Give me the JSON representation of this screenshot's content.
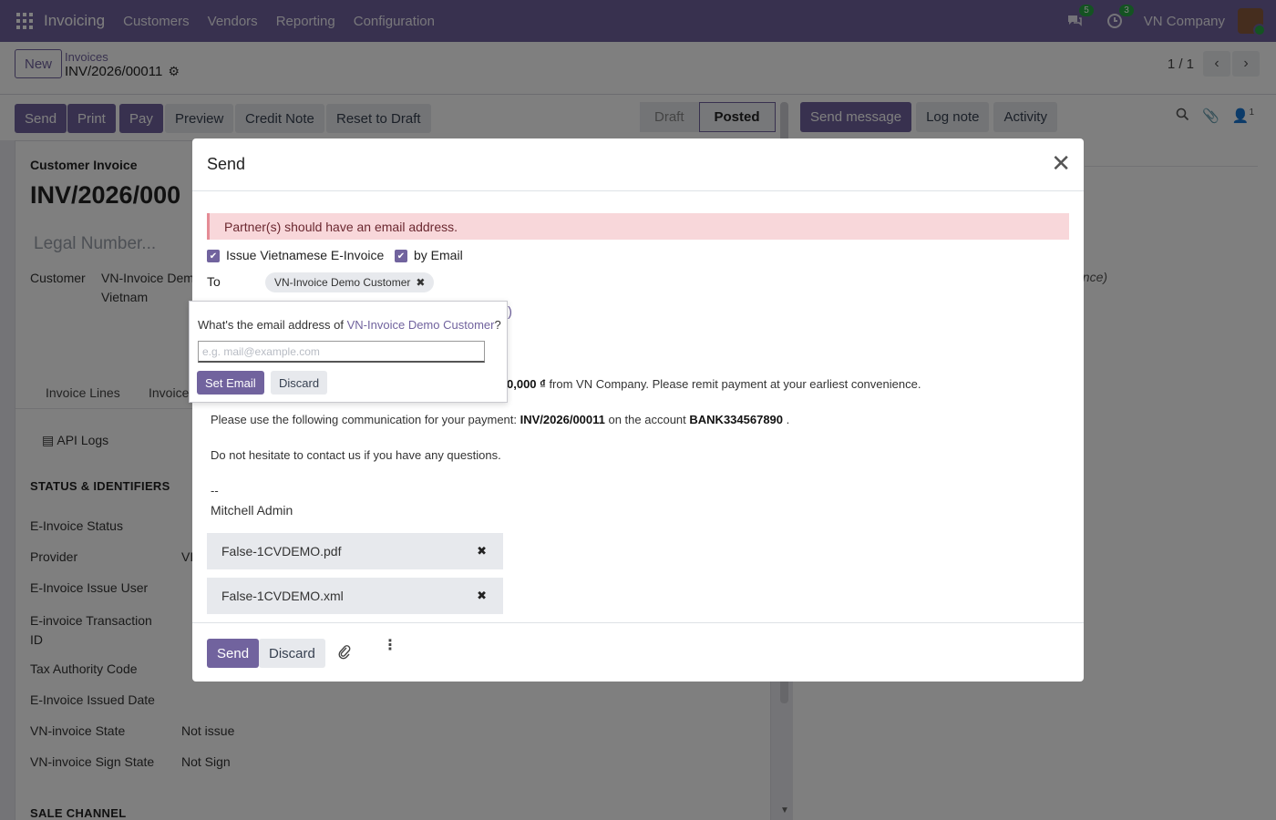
{
  "navbar": {
    "app_name": "Invoicing",
    "menu": [
      "Customers",
      "Vendors",
      "Reporting",
      "Configuration"
    ],
    "messages_badge": "5",
    "activities_badge": "3",
    "company": "VN Company"
  },
  "control_panel": {
    "new_label": "New",
    "breadcrumb_parent": "Invoices",
    "breadcrumb_current": "INV/2026/00011",
    "pager": "1 / 1"
  },
  "actionbar": {
    "buttons": [
      "Send",
      "Print",
      "Pay",
      "Preview",
      "Credit Note",
      "Reset to Draft"
    ],
    "statuses": [
      "Draft",
      "Posted"
    ],
    "chatter_buttons": [
      "Send message",
      "Log note",
      "Activity"
    ],
    "followers_count": "1"
  },
  "form": {
    "type_label": "Customer Invoice",
    "number": "INV/2026/000",
    "legal_placeholder": "Legal Number...",
    "customer_label": "Customer",
    "customer_name": "VN-Invoice Dem",
    "customer_country": "Vietnam",
    "tabs": [
      "Invoice Lines",
      "Invoice"
    ],
    "api_logs": "API Logs",
    "section_status": "STATUS & IDENTIFIERS",
    "fields": [
      {
        "label": "E-Invoice Status",
        "value": ""
      },
      {
        "label": "Provider",
        "value": "VI"
      },
      {
        "label": "E-Invoice Issue User",
        "value": ""
      },
      {
        "label": "E-invoice Transaction ID",
        "value": ""
      },
      {
        "label": "Tax Authority Code",
        "value": ""
      },
      {
        "label": "E-Invoice Issued Date",
        "value": ""
      },
      {
        "label": "VN-invoice State",
        "value": "Not issue"
      },
      {
        "label": "VN-invoice Sign State",
        "value": "Not Sign"
      }
    ],
    "section_sale": "SALE CHANNEL",
    "chatter_snippet": "ence)"
  },
  "modal": {
    "title": "Send",
    "alert": "Partner(s) should have an email address.",
    "opt_einvoice": "Issue Vietnamese E-Invoice",
    "opt_email": "by Email",
    "to_label": "To",
    "recipient": "VN-Invoice Demo Customer",
    "peek_text": ")",
    "body_line1_amount": "0,000 ₫",
    "body_line1_rest": " from VN Company. Please remit payment at your earliest convenience.",
    "body_line2_pre": "Please use the following communication for your payment: ",
    "body_line2_ref": "INV/2026/00011",
    "body_line2_mid": " on the account ",
    "body_line2_acc": "BANK334567890",
    "body_line2_end": " .",
    "body_line3": "Do not hesitate to contact us if you have any questions.",
    "signature_sep": "--",
    "signature_name": "Mitchell Admin",
    "attachments": [
      "False-1CVDEMO.pdf",
      "False-1CVDEMO.xml"
    ],
    "footer_send": "Send",
    "footer_discard": "Discard"
  },
  "popover": {
    "question_pre": "What's the email address of ",
    "question_name": "VN-Invoice Demo Customer",
    "question_post": "?",
    "input_placeholder": "e.g. mail@example.com",
    "input_value": "",
    "set_email": "Set Email",
    "discard": "Discard"
  }
}
